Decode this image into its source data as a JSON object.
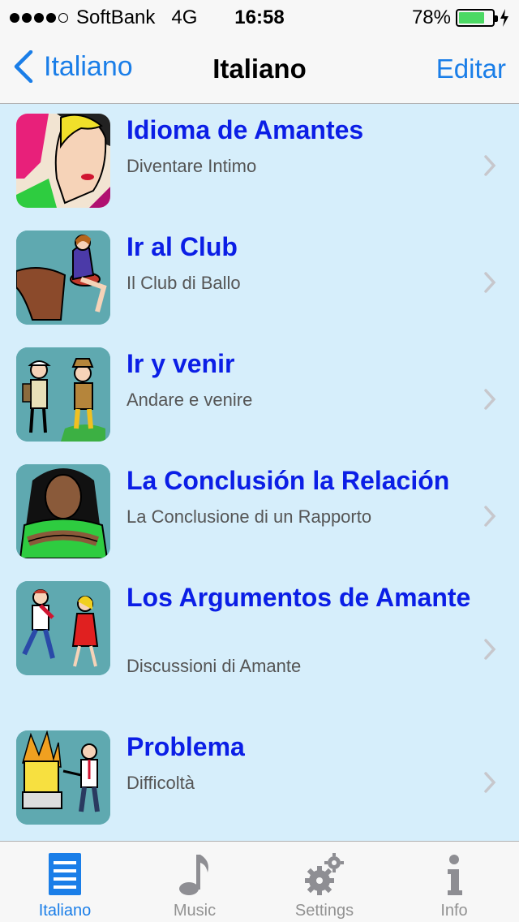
{
  "status_bar": {
    "carrier": "SoftBank",
    "network": "4G",
    "time": "16:58",
    "battery": "78%",
    "battery_level": 0.78,
    "signal_bars": 4,
    "signal_max": 5
  },
  "nav": {
    "back_label": "Italiano",
    "title": "Italiano",
    "edit_label": "Editar"
  },
  "colors": {
    "accent": "#1a7ee8",
    "title_blue": "#0b1ee6",
    "list_background": "#d6eefb"
  },
  "lessons": [
    {
      "title": "Idioma de Amantes",
      "subtitle": "Diventare Intimo",
      "icon": "lovers-illustration"
    },
    {
      "title": "Ir al Club",
      "subtitle": "Il Club di Ballo",
      "icon": "club-woman-illustration"
    },
    {
      "title": "Ir y venir",
      "subtitle": "Andare e venire",
      "icon": "travelers-illustration"
    },
    {
      "title": "La Conclusión la Relación",
      "subtitle": "La Conclusione di un Rapporto",
      "icon": "woman-arms-crossed-illustration"
    },
    {
      "title": "Los Argumentos de Amante",
      "subtitle": "Discussioni di Amante",
      "icon": "arguing-couple-illustration"
    },
    {
      "title": "Problema",
      "subtitle": "Difficoltà",
      "icon": "burning-computer-illustration"
    }
  ],
  "tabs": [
    {
      "label": "Italiano",
      "icon": "list-icon",
      "active": true
    },
    {
      "label": "Music",
      "icon": "music-note-icon",
      "active": false
    },
    {
      "label": "Settings",
      "icon": "gears-icon",
      "active": false
    },
    {
      "label": "Info",
      "icon": "info-icon",
      "active": false
    }
  ]
}
